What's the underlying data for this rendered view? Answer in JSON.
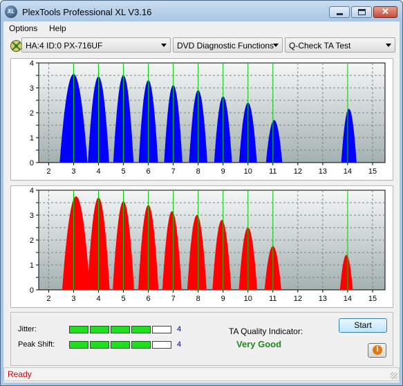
{
  "window": {
    "title": "PlexTools Professional XL V3.16",
    "logo_text": "XL",
    "controls": {
      "minimize": "minimize",
      "maximize": "maximize",
      "close": "✕"
    }
  },
  "menu": {
    "items": [
      "Options",
      "Help"
    ]
  },
  "toolbar": {
    "drive_icon": "cd-drive-icon",
    "drive": "HA:4 ID:0  PX-716UF",
    "function": "DVD Diagnostic Functions",
    "test": "Q-Check TA Test"
  },
  "colors": {
    "plot_top": "#f4f6f6",
    "plot_bottom": "#a4b0b0",
    "land_fill": "#0000ff",
    "pit_fill": "#ff0000",
    "green_line": "#00d000",
    "quality_text": "#1c8c1c",
    "status_text": "#cc0000"
  },
  "chart_data": [
    {
      "type": "area",
      "title": "",
      "xlabel": "",
      "ylabel": "",
      "xlim": [
        1.6,
        15.5
      ],
      "ylim": [
        0,
        4
      ],
      "x_ticks": [
        "2",
        "3",
        "4",
        "5",
        "6",
        "7",
        "8",
        "9",
        "10",
        "11",
        "12",
        "13",
        "14",
        "15"
      ],
      "y_ticks": [
        "0",
        "0.5",
        "1",
        "1.5",
        "2",
        "2.5",
        "3",
        "3.5",
        "4"
      ],
      "grid": true,
      "green_markers_x": [
        3,
        4,
        5,
        6,
        7,
        8,
        9,
        10,
        11,
        14
      ],
      "peaks": [
        {
          "center": 3.0,
          "height": 3.55,
          "halfwidth": 0.55
        },
        {
          "center": 4.0,
          "height": 3.45,
          "halfwidth": 0.42
        },
        {
          "center": 5.0,
          "height": 3.5,
          "halfwidth": 0.4
        },
        {
          "center": 6.0,
          "height": 3.3,
          "halfwidth": 0.38
        },
        {
          "center": 7.0,
          "height": 3.1,
          "halfwidth": 0.36
        },
        {
          "center": 8.0,
          "height": 2.9,
          "halfwidth": 0.36
        },
        {
          "center": 9.0,
          "height": 2.65,
          "halfwidth": 0.35
        },
        {
          "center": 10.0,
          "height": 2.4,
          "halfwidth": 0.35
        },
        {
          "center": 11.05,
          "height": 1.7,
          "halfwidth": 0.32
        },
        {
          "center": 14.05,
          "height": 2.15,
          "halfwidth": 0.3
        }
      ]
    },
    {
      "type": "area",
      "title": "",
      "xlabel": "",
      "ylabel": "",
      "xlim": [
        1.6,
        15.5
      ],
      "ylim": [
        0,
        4
      ],
      "x_ticks": [
        "2",
        "3",
        "4",
        "5",
        "6",
        "7",
        "8",
        "9",
        "10",
        "11",
        "12",
        "13",
        "14",
        "15"
      ],
      "y_ticks": [
        "0",
        "0.5",
        "1",
        "1.5",
        "2",
        "2.5",
        "3",
        "3.5",
        "4"
      ],
      "grid": true,
      "green_markers_x": [
        3,
        4,
        5,
        6,
        7,
        8,
        9,
        10,
        11,
        14
      ],
      "peaks": [
        {
          "center": 3.1,
          "height": 3.75,
          "halfwidth": 0.55
        },
        {
          "center": 4.0,
          "height": 3.7,
          "halfwidth": 0.44
        },
        {
          "center": 5.0,
          "height": 3.55,
          "halfwidth": 0.42
        },
        {
          "center": 6.0,
          "height": 3.4,
          "halfwidth": 0.4
        },
        {
          "center": 6.95,
          "height": 3.15,
          "halfwidth": 0.38
        },
        {
          "center": 7.95,
          "height": 3.0,
          "halfwidth": 0.38
        },
        {
          "center": 8.95,
          "height": 2.8,
          "halfwidth": 0.37
        },
        {
          "center": 10.0,
          "height": 2.5,
          "halfwidth": 0.36
        },
        {
          "center": 11.0,
          "height": 1.75,
          "halfwidth": 0.33
        },
        {
          "center": 13.95,
          "height": 1.4,
          "halfwidth": 0.25
        }
      ]
    }
  ],
  "metrics": {
    "jitter_label": "Jitter:",
    "jitter_value": "4",
    "jitter_level": 4,
    "peak_shift_label": "Peak Shift:",
    "peak_shift_value": "4",
    "peak_shift_level": 4,
    "segments": 5
  },
  "quality": {
    "label": "TA Quality Indicator:",
    "value": "Very Good"
  },
  "buttons": {
    "start": "Start",
    "info_icon": "info-icon"
  },
  "status": {
    "text": "Ready"
  }
}
